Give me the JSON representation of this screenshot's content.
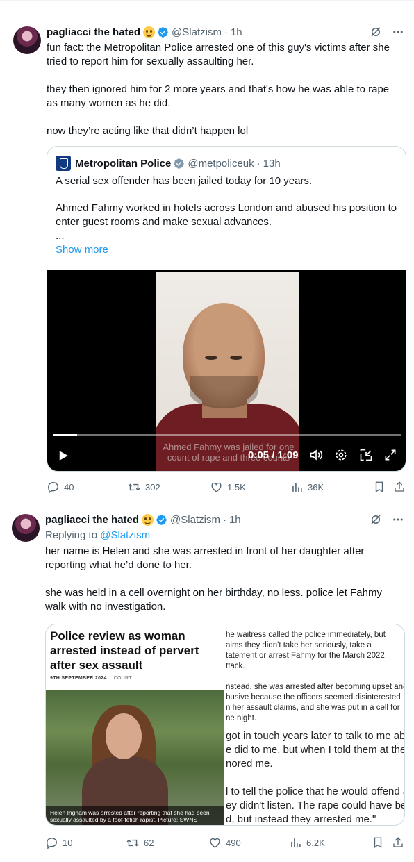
{
  "tweets": [
    {
      "author": {
        "name": "pagliacci the hated",
        "handle": "@Slatzism",
        "time": "1h",
        "verified": true,
        "emoji": "slightly-smiling-face"
      },
      "paragraphs": [
        "fun fact: the Metropolitan Police arrested one of this guy's victims after she tried to report him for sexually assaulting her.",
        "they then ignored him for 2 more years and that's how he was able to rape as many women as he did.",
        "now they’re acting like that didn’t happen lol"
      ],
      "quote": {
        "author": {
          "name": "Metropolitan Police",
          "handle": "@metpoliceuk",
          "time": "13h",
          "verified": true
        },
        "paragraphs": [
          "A serial sex offender has been jailed today for 10 years.",
          "Ahmed Fahmy worked in hotels across London and abused his position to enter guest rooms and make sexual advances.",
          "..."
        ],
        "show_more": "Show more",
        "video": {
          "caption": "Ahmed Fahmy was jailed for one count of rape and three counts",
          "time": "0:05 / 1:09",
          "progress": 0.07
        }
      },
      "stats": {
        "replies": "40",
        "reposts": "302",
        "likes": "1.5K",
        "views": "36K"
      }
    },
    {
      "author": {
        "name": "pagliacci the hated",
        "handle": "@Slatzism",
        "time": "1h",
        "verified": true,
        "emoji": "slightly-smiling-face"
      },
      "replying_prefix": "Replying to",
      "replying_to": "@Slatzism",
      "paragraphs": [
        "her name is Helen and she was arrested in front of her daughter after reporting what he’d done to her.",
        "she was held in a cell overnight on her birthday, no less. police let Fahmy walk with no investigation."
      ],
      "article": {
        "headline": "Police review as woman arrested instead of pervert after sex assault",
        "date": "9TH SEPTEMBER 2024",
        "section": "COURT",
        "photo_caption": "Helen Ingham was arrested after reporting that she had been sexually assaulted by a foot-fetish rapist. Picture: SWNS",
        "body_small": "he waitress called the police immediately, but\naims they didn't take her seriously, take a\ntatement or arrest Fahmy for the March 2022\nttack.\n\nnstead, she was arrested after becoming upset and\nbusive because the officers seemed disinterested\nn her assault claims, and she was put in a cell for\nne night.",
        "body_large": "got in touch years later to talk to me abo\ne did to me, but when I told them at the\nnored me.\n\nl to tell the police that he would offend a\ney didn't listen. The rape could have bee\nd, but instead they arrested me.\""
      },
      "stats": {
        "replies": "10",
        "reposts": "62",
        "likes": "490",
        "views": "6.2K"
      }
    }
  ]
}
